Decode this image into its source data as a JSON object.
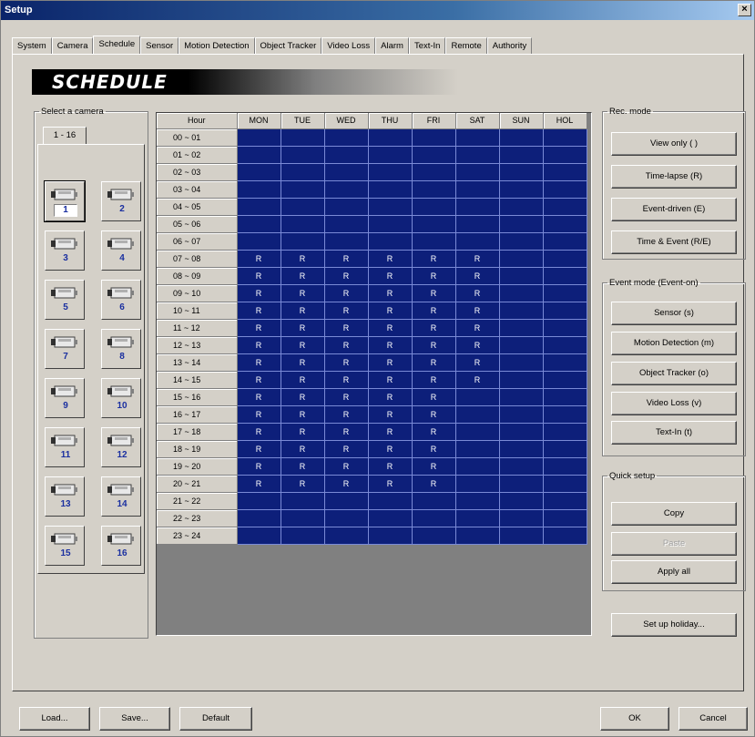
{
  "window": {
    "title": "Setup",
    "close_glyph": "×"
  },
  "tabs": [
    {
      "label": "System",
      "active": false
    },
    {
      "label": "Camera",
      "active": false
    },
    {
      "label": "Schedule",
      "active": true
    },
    {
      "label": "Sensor",
      "active": false
    },
    {
      "label": "Motion Detection",
      "active": false
    },
    {
      "label": "Object Tracker",
      "active": false
    },
    {
      "label": "Video Loss",
      "active": false
    },
    {
      "label": "Alarm",
      "active": false
    },
    {
      "label": "Text-In",
      "active": false
    },
    {
      "label": "Remote",
      "active": false
    },
    {
      "label": "Authority",
      "active": false
    }
  ],
  "banner": {
    "title": "SCHEDULE"
  },
  "camera_select": {
    "legend": "Select a camera",
    "tab_label": "1 - 16",
    "selected": "1",
    "cameras": [
      "1",
      "2",
      "3",
      "4",
      "5",
      "6",
      "7",
      "8",
      "9",
      "10",
      "11",
      "12",
      "13",
      "14",
      "15",
      "16"
    ]
  },
  "schedule": {
    "hour_header": "Hour",
    "days": [
      "MON",
      "TUE",
      "WED",
      "THU",
      "FRI",
      "SAT",
      "SUN",
      "HOL"
    ],
    "hours": [
      "00 ~ 01",
      "01 ~ 02",
      "02 ~ 03",
      "03 ~ 04",
      "04 ~ 05",
      "05 ~ 06",
      "06 ~ 07",
      "07 ~ 08",
      "08 ~ 09",
      "09 ~ 10",
      "10 ~ 11",
      "11 ~ 12",
      "12 ~ 13",
      "13 ~ 14",
      "14 ~ 15",
      "15 ~ 16",
      "16 ~ 17",
      "17 ~ 18",
      "18 ~ 19",
      "19 ~ 20",
      "20 ~ 21",
      "21 ~ 22",
      "22 ~ 23",
      "23 ~ 24"
    ],
    "cells": [
      [
        "",
        "",
        "",
        "",
        "",
        "",
        "",
        ""
      ],
      [
        "",
        "",
        "",
        "",
        "",
        "",
        "",
        ""
      ],
      [
        "",
        "",
        "",
        "",
        "",
        "",
        "",
        ""
      ],
      [
        "",
        "",
        "",
        "",
        "",
        "",
        "",
        ""
      ],
      [
        "",
        "",
        "",
        "",
        "",
        "",
        "",
        ""
      ],
      [
        "",
        "",
        "",
        "",
        "",
        "",
        "",
        ""
      ],
      [
        "",
        "",
        "",
        "",
        "",
        "",
        "",
        ""
      ],
      [
        "R",
        "R",
        "R",
        "R",
        "R",
        "R",
        "",
        ""
      ],
      [
        "R",
        "R",
        "R",
        "R",
        "R",
        "R",
        "",
        ""
      ],
      [
        "R",
        "R",
        "R",
        "R",
        "R",
        "R",
        "",
        ""
      ],
      [
        "R",
        "R",
        "R",
        "R",
        "R",
        "R",
        "",
        ""
      ],
      [
        "R",
        "R",
        "R",
        "R",
        "R",
        "R",
        "",
        ""
      ],
      [
        "R",
        "R",
        "R",
        "R",
        "R",
        "R",
        "",
        ""
      ],
      [
        "R",
        "R",
        "R",
        "R",
        "R",
        "R",
        "",
        ""
      ],
      [
        "R",
        "R",
        "R",
        "R",
        "R",
        "R",
        "",
        ""
      ],
      [
        "R",
        "R",
        "R",
        "R",
        "R",
        "",
        "",
        ""
      ],
      [
        "R",
        "R",
        "R",
        "R",
        "R",
        "",
        "",
        ""
      ],
      [
        "R",
        "R",
        "R",
        "R",
        "R",
        "",
        "",
        ""
      ],
      [
        "R",
        "R",
        "R",
        "R",
        "R",
        "",
        "",
        ""
      ],
      [
        "R",
        "R",
        "R",
        "R",
        "R",
        "",
        "",
        ""
      ],
      [
        "R",
        "R",
        "R",
        "R",
        "R",
        "",
        "",
        ""
      ],
      [
        "",
        "",
        "",
        "",
        "",
        "",
        "",
        ""
      ],
      [
        "",
        "",
        "",
        "",
        "",
        "",
        "",
        ""
      ],
      [
        "",
        "",
        "",
        "",
        "",
        "",
        "",
        ""
      ]
    ]
  },
  "rec_mode": {
    "legend": "Rec. mode",
    "buttons": [
      "View only ( )",
      "Time-lapse (R)",
      "Event-driven (E)",
      "Time & Event (R/E)"
    ]
  },
  "event_mode": {
    "legend": "Event mode (Event-on)",
    "buttons": [
      "Sensor (s)",
      "Motion Detection (m)",
      "Object Tracker (o)",
      "Video Loss (v)",
      "Text-In (t)"
    ]
  },
  "quick_setup": {
    "legend": "Quick setup",
    "copy": "Copy",
    "paste": "Paste",
    "apply_all": "Apply all"
  },
  "holiday_button": "Set up holiday...",
  "footer": {
    "load": "Load...",
    "save": "Save...",
    "default": "Default",
    "ok": "OK",
    "cancel": "Cancel"
  },
  "colors": {
    "schedule_cell": "#0d1f7a",
    "face": "#d4d0c8",
    "title_bar": "#0a246a"
  }
}
